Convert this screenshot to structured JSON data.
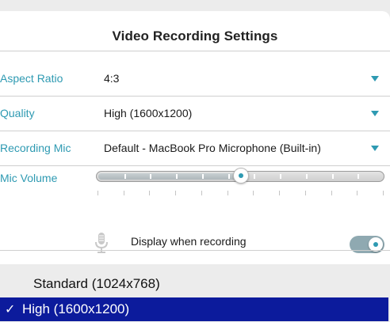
{
  "dialog": {
    "title": "Video Recording Settings",
    "rows": [
      {
        "label": "Aspect Ratio",
        "value": "4:3"
      },
      {
        "label": "Quality",
        "value": "High (1600x1200)"
      },
      {
        "label": "Recording Mic",
        "value": "Default - MacBook Pro Microphone (Built-in)"
      }
    ],
    "mic_volume": {
      "label": "Mic Volume",
      "level": 0.5
    },
    "display_when_recording": {
      "label": "Display when recording",
      "enabled": true
    }
  },
  "dropdown": {
    "options": [
      {
        "label": "Standard (1024x768)",
        "selected": false
      },
      {
        "label": "High (1600x1200)",
        "selected": true
      }
    ],
    "check_mark": "✓"
  },
  "colors": {
    "accent": "#2e9ab2",
    "selection": "#0c1b9c"
  },
  "icons": {
    "caret": "chevron-down-icon",
    "mic": "microphone-icon",
    "check": "checkmark-icon"
  }
}
